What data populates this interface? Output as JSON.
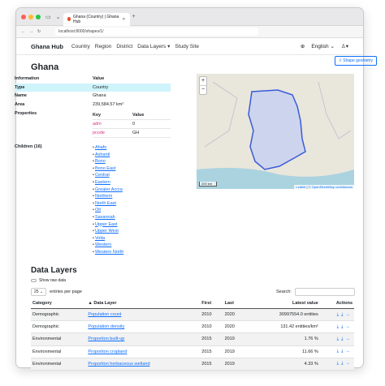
{
  "browser": {
    "tab_title": "Ghana (Country) | Ghana Hub",
    "url": "localhost:8000/shapes/1/"
  },
  "nav": {
    "brand": "Ghana Hub",
    "links": [
      "Country",
      "Region",
      "District",
      "Data Layers",
      "Study Site"
    ],
    "language": "English"
  },
  "page": {
    "title": "Ghana",
    "shape_button": "Shape geometry"
  },
  "info": {
    "header_info": "Information",
    "header_value": "Value",
    "rows": [
      {
        "k": "Type",
        "v": "Country"
      },
      {
        "k": "Name",
        "v": "Ghana"
      },
      {
        "k": "Area",
        "v": "239,584.57 km²"
      }
    ],
    "properties_label": "Properties",
    "prop_key": "Key",
    "prop_value": "Value",
    "props": [
      {
        "k": "adm",
        "v": "0"
      },
      {
        "k": "pcode",
        "v": "GH"
      }
    ],
    "children_label": "Children (16)",
    "children": [
      "Ahafo",
      "Ashanti",
      "Bono",
      "Bono East",
      "Central",
      "Eastern",
      "Greater Accra",
      "Northern",
      "North East",
      "Oti",
      "Savannah",
      "Upper East",
      "Upper West",
      "Volta",
      "Western",
      "Western North"
    ]
  },
  "map": {
    "scale": "200 km",
    "attrib_leaflet": "Leaflet",
    "attrib_osm": "© OpenStreetMap contributors"
  },
  "layers": {
    "title": "Data Layers",
    "raw_label": "Show raw data",
    "page_size": "25",
    "entries_label": "entries per page",
    "search_label": "Search:",
    "headers": [
      "Category",
      "Data Layer",
      "First",
      "Last",
      "Latest value",
      "Actions"
    ],
    "rows": [
      {
        "cat": "Demographic",
        "layer": "Population count",
        "first": "2010",
        "last": "2020",
        "val": "30997554.0 entities"
      },
      {
        "cat": "Demographic",
        "layer": "Population density",
        "first": "2010",
        "last": "2020",
        "val": "131.42 entities/km²"
      },
      {
        "cat": "Environmental",
        "layer": "Proportion built-up",
        "first": "2015",
        "last": "2019",
        "val": "1.76 %"
      },
      {
        "cat": "Environmental",
        "layer": "Proportion cropland",
        "first": "2015",
        "last": "2019",
        "val": "11.66 %"
      },
      {
        "cat": "Environmental",
        "layer": "Proportion herbaceous wetland",
        "first": "2015",
        "last": "2019",
        "val": "4.33 %"
      }
    ]
  }
}
